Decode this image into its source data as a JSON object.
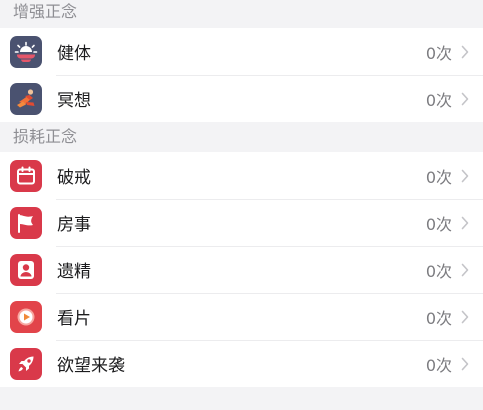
{
  "sections": [
    {
      "header": "增强正念",
      "items": [
        {
          "label": "健体",
          "count": "0次",
          "icon": "sunrise-icon",
          "color": "#4a5270"
        },
        {
          "label": "冥想",
          "count": "0次",
          "icon": "meditation-icon",
          "color": "#4a5270"
        }
      ]
    },
    {
      "header": "损耗正念",
      "items": [
        {
          "label": "破戒",
          "count": "0次",
          "icon": "calendar-icon",
          "color": "#d9394a"
        },
        {
          "label": "房事",
          "count": "0次",
          "icon": "flag-icon",
          "color": "#d9394a"
        },
        {
          "label": "遗精",
          "count": "0次",
          "icon": "person-icon",
          "color": "#d9394a"
        },
        {
          "label": "看片",
          "count": "0次",
          "icon": "play-icon",
          "color": "#e2444a"
        },
        {
          "label": "欲望来袭",
          "count": "0次",
          "icon": "rocket-icon",
          "color": "#d9394a"
        }
      ]
    }
  ]
}
